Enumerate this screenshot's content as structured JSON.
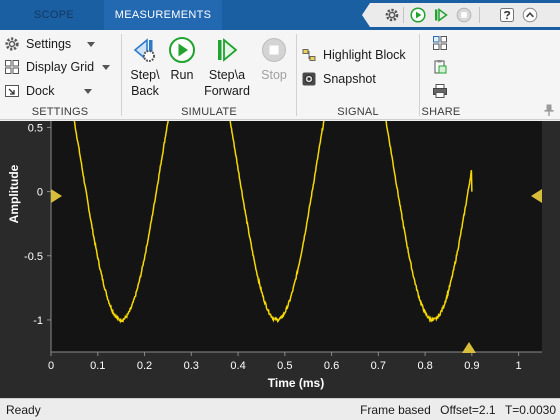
{
  "tabs": {
    "scope": "SCOPE",
    "measurements": "MEASUREMENTS"
  },
  "quick_access": [
    "settings-icon",
    "run-icon",
    "step-forward-icon",
    "stop-icon",
    "help-icon",
    "collapse-icon"
  ],
  "ribbon": {
    "settings": {
      "items": [
        "Settings",
        "Display Grid",
        "Dock"
      ],
      "group_label": "SETTINGS"
    },
    "simulate": {
      "step_back": "Step\\ Back",
      "run": "Run",
      "step_forward": "Step\\a Forward",
      "stop": "Stop",
      "group_label": "SIMULATE"
    },
    "signal": {
      "highlight_block": "Highlight Block",
      "snapshot": "Snapshot",
      "group_label": "SIGNAL"
    },
    "share": {
      "group_label": "SHARE"
    }
  },
  "chart_data": {
    "type": "line",
    "xlabel": "Time (ms)",
    "ylabel": "Amplitude",
    "xlim": [
      0,
      1.05
    ],
    "ylim": [
      -1.25,
      0.55
    ],
    "xticks": [
      "0",
      "0.1",
      "0.2",
      "0.3",
      "0.4",
      "0.5",
      "0.6",
      "0.7",
      "0.8",
      "0.9",
      "1"
    ],
    "yticks": [
      "0.5",
      "0",
      "-0.5",
      "-1"
    ],
    "series": [
      {
        "color": "#f5d800",
        "description": "noisy periodic waveform, period about 0.333 ms, minima about -1 at t = 0.15, 0.48, 0.815; trace ends at t = 0.9 with value 0",
        "x_end": 0.9,
        "period": 0.3333,
        "min_times": [
          0.15,
          0.4833,
          0.8167
        ],
        "min_value": -1.0
      }
    ],
    "background": "#141414",
    "grid": false
  },
  "status": {
    "left": "Ready",
    "mode": "Frame based",
    "offset": "Offset=2.1",
    "time": "T=0.0030"
  },
  "colors": {
    "titlebar": "#1b5fa3",
    "trace": "#f5d800",
    "plot_background": "#141414",
    "axis_text": "#ffffff"
  }
}
